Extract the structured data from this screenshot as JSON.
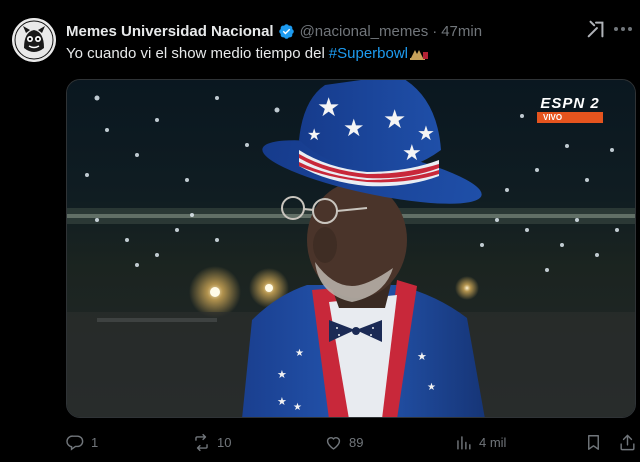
{
  "author": {
    "name": "Memes Universidad Nacional",
    "handle": "@nacional_memes",
    "separator": "·",
    "time": "47min"
  },
  "tweet": {
    "text": "Yo cuando vi el show medio tiempo del",
    "hashtag": "#Superbowl"
  },
  "media": {
    "broadcast_logo": "ESPN 2",
    "broadcast_status": "VIVO"
  },
  "actions": {
    "replies": "1",
    "reposts": "10",
    "likes": "89",
    "views": "4 mil"
  },
  "colors": {
    "accent": "#1d9bf0",
    "muted": "#71767b",
    "background": "#000000"
  }
}
